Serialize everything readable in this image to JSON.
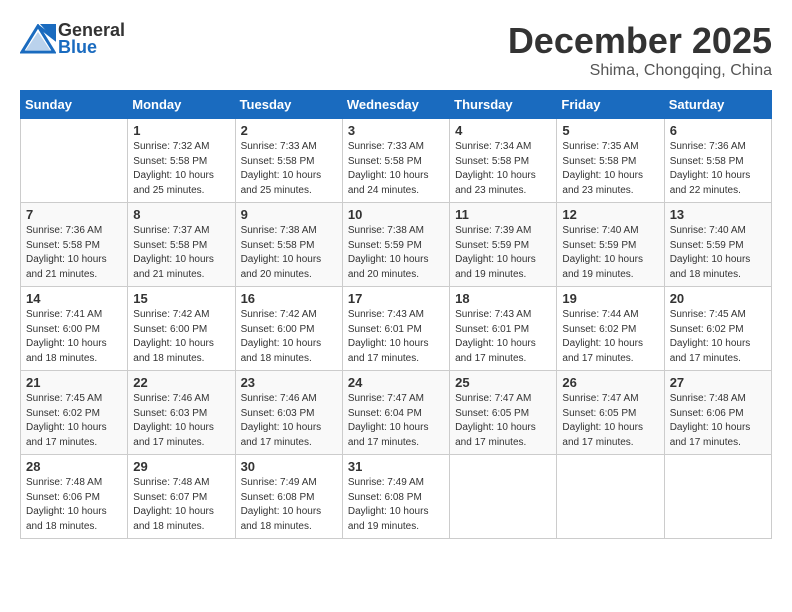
{
  "header": {
    "logo_general": "General",
    "logo_blue": "Blue",
    "month": "December 2025",
    "location": "Shima, Chongqing, China"
  },
  "weekdays": [
    "Sunday",
    "Monday",
    "Tuesday",
    "Wednesday",
    "Thursday",
    "Friday",
    "Saturday"
  ],
  "weeks": [
    [
      {
        "day": "",
        "info": ""
      },
      {
        "day": "1",
        "info": "Sunrise: 7:32 AM\nSunset: 5:58 PM\nDaylight: 10 hours\nand 25 minutes."
      },
      {
        "day": "2",
        "info": "Sunrise: 7:33 AM\nSunset: 5:58 PM\nDaylight: 10 hours\nand 25 minutes."
      },
      {
        "day": "3",
        "info": "Sunrise: 7:33 AM\nSunset: 5:58 PM\nDaylight: 10 hours\nand 24 minutes."
      },
      {
        "day": "4",
        "info": "Sunrise: 7:34 AM\nSunset: 5:58 PM\nDaylight: 10 hours\nand 23 minutes."
      },
      {
        "day": "5",
        "info": "Sunrise: 7:35 AM\nSunset: 5:58 PM\nDaylight: 10 hours\nand 23 minutes."
      },
      {
        "day": "6",
        "info": "Sunrise: 7:36 AM\nSunset: 5:58 PM\nDaylight: 10 hours\nand 22 minutes."
      }
    ],
    [
      {
        "day": "7",
        "info": "Sunrise: 7:36 AM\nSunset: 5:58 PM\nDaylight: 10 hours\nand 21 minutes."
      },
      {
        "day": "8",
        "info": "Sunrise: 7:37 AM\nSunset: 5:58 PM\nDaylight: 10 hours\nand 21 minutes."
      },
      {
        "day": "9",
        "info": "Sunrise: 7:38 AM\nSunset: 5:58 PM\nDaylight: 10 hours\nand 20 minutes."
      },
      {
        "day": "10",
        "info": "Sunrise: 7:38 AM\nSunset: 5:59 PM\nDaylight: 10 hours\nand 20 minutes."
      },
      {
        "day": "11",
        "info": "Sunrise: 7:39 AM\nSunset: 5:59 PM\nDaylight: 10 hours\nand 19 minutes."
      },
      {
        "day": "12",
        "info": "Sunrise: 7:40 AM\nSunset: 5:59 PM\nDaylight: 10 hours\nand 19 minutes."
      },
      {
        "day": "13",
        "info": "Sunrise: 7:40 AM\nSunset: 5:59 PM\nDaylight: 10 hours\nand 18 minutes."
      }
    ],
    [
      {
        "day": "14",
        "info": "Sunrise: 7:41 AM\nSunset: 6:00 PM\nDaylight: 10 hours\nand 18 minutes."
      },
      {
        "day": "15",
        "info": "Sunrise: 7:42 AM\nSunset: 6:00 PM\nDaylight: 10 hours\nand 18 minutes."
      },
      {
        "day": "16",
        "info": "Sunrise: 7:42 AM\nSunset: 6:00 PM\nDaylight: 10 hours\nand 18 minutes."
      },
      {
        "day": "17",
        "info": "Sunrise: 7:43 AM\nSunset: 6:01 PM\nDaylight: 10 hours\nand 17 minutes."
      },
      {
        "day": "18",
        "info": "Sunrise: 7:43 AM\nSunset: 6:01 PM\nDaylight: 10 hours\nand 17 minutes."
      },
      {
        "day": "19",
        "info": "Sunrise: 7:44 AM\nSunset: 6:02 PM\nDaylight: 10 hours\nand 17 minutes."
      },
      {
        "day": "20",
        "info": "Sunrise: 7:45 AM\nSunset: 6:02 PM\nDaylight: 10 hours\nand 17 minutes."
      }
    ],
    [
      {
        "day": "21",
        "info": "Sunrise: 7:45 AM\nSunset: 6:02 PM\nDaylight: 10 hours\nand 17 minutes."
      },
      {
        "day": "22",
        "info": "Sunrise: 7:46 AM\nSunset: 6:03 PM\nDaylight: 10 hours\nand 17 minutes."
      },
      {
        "day": "23",
        "info": "Sunrise: 7:46 AM\nSunset: 6:03 PM\nDaylight: 10 hours\nand 17 minutes."
      },
      {
        "day": "24",
        "info": "Sunrise: 7:47 AM\nSunset: 6:04 PM\nDaylight: 10 hours\nand 17 minutes."
      },
      {
        "day": "25",
        "info": "Sunrise: 7:47 AM\nSunset: 6:05 PM\nDaylight: 10 hours\nand 17 minutes."
      },
      {
        "day": "26",
        "info": "Sunrise: 7:47 AM\nSunset: 6:05 PM\nDaylight: 10 hours\nand 17 minutes."
      },
      {
        "day": "27",
        "info": "Sunrise: 7:48 AM\nSunset: 6:06 PM\nDaylight: 10 hours\nand 17 minutes."
      }
    ],
    [
      {
        "day": "28",
        "info": "Sunrise: 7:48 AM\nSunset: 6:06 PM\nDaylight: 10 hours\nand 18 minutes."
      },
      {
        "day": "29",
        "info": "Sunrise: 7:48 AM\nSunset: 6:07 PM\nDaylight: 10 hours\nand 18 minutes."
      },
      {
        "day": "30",
        "info": "Sunrise: 7:49 AM\nSunset: 6:08 PM\nDaylight: 10 hours\nand 18 minutes."
      },
      {
        "day": "31",
        "info": "Sunrise: 7:49 AM\nSunset: 6:08 PM\nDaylight: 10 hours\nand 19 minutes."
      },
      {
        "day": "",
        "info": ""
      },
      {
        "day": "",
        "info": ""
      },
      {
        "day": "",
        "info": ""
      }
    ]
  ]
}
